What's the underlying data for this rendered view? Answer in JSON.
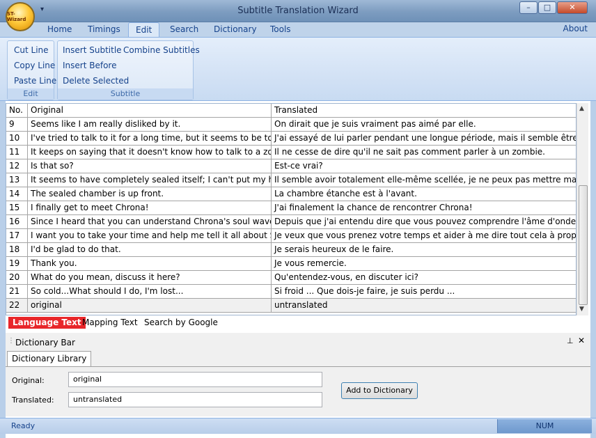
{
  "window": {
    "title": "Subtitle Translation Wizard",
    "app_button_label": "ST-Wizard",
    "minimize": "–",
    "maximize": "□",
    "close": "✕"
  },
  "ribbon_tabs": [
    "Home",
    "Timings",
    "Edit",
    "Search",
    "Dictionary",
    "Tools"
  ],
  "about_label": "About",
  "ribbon": {
    "edit_group": {
      "label": "Edit",
      "cut": "Cut Line",
      "copy": "Copy Line",
      "paste": "Paste Line"
    },
    "subtitle_group": {
      "label": "Subtitle",
      "insert": "Insert Subtitle",
      "insert_before": "Insert Before",
      "delete": "Delete Selected",
      "combine": "Combine Subtitles"
    }
  },
  "grid": {
    "headers": [
      "No.",
      "Original",
      "Translated"
    ],
    "rows": [
      {
        "no": "9",
        "orig": "Seems like I am really disliked by it.",
        "trans": "On dirait que je suis vraiment pas aimé par elle."
      },
      {
        "no": "10",
        "orig": "I've tried to talk to it for a long time, but it seems to be too scare...",
        "trans": "J'ai essayé de lui parler pendant une longue période, mais il semble être trop effr..."
      },
      {
        "no": "11",
        "orig": "It keeps on saying that it doesn't know how to talk to a zombie.",
        "trans": "Il ne cesse de dire qu'il ne sait pas comment parler à un zombie."
      },
      {
        "no": "12",
        "orig": "Is that so?",
        "trans": "Est-ce vrai?"
      },
      {
        "no": "13",
        "orig": "It seems to have completely sealed itself; I can't put my hand in.",
        "trans": "Il semble avoir totalement elle-même scellée, je ne peux pas mettre ma main po"
      },
      {
        "no": "14",
        "orig": "The sealed chamber is up front.",
        "trans": "La chambre étanche est à l'avant."
      },
      {
        "no": "15",
        "orig": "I finally get to meet Chrona!",
        "trans": "J'ai finalement la chance de rencontrer Chrona!"
      },
      {
        "no": "16",
        "orig": "Since I heard that you can understand Chrona's soul wavelengt...",
        "trans": "Depuis que j'ai entendu dire que vous pouvez comprendre l'âme d'onde Chrona ..."
      },
      {
        "no": "17",
        "orig": "I want you to take your time and help me tell it all about Shibus...",
        "trans": "Je veux que vous prenez votre temps et aider à me dire tout cela à propos Shibus..."
      },
      {
        "no": "18",
        "orig": "I'd be glad to do that.",
        "trans": "Je serais heureux de le faire."
      },
      {
        "no": "19",
        "orig": "Thank you.",
        "trans": "Je vous remercie."
      },
      {
        "no": "20",
        "orig": "What do you mean, discuss it here?",
        "trans": "Qu'entendez-vous, en discuter ici?"
      },
      {
        "no": "21",
        "orig": "So cold...What should I do, I'm lost...",
        "trans": "Si froid ... Que dois-je faire, je suis perdu ..."
      },
      {
        "no": "22",
        "orig": "original",
        "trans": "untranslated"
      }
    ]
  },
  "bottom_tabs": [
    "Language Text",
    "Mapping Text",
    "Search by Google"
  ],
  "dictionary": {
    "bar_title": "Dictionary Bar",
    "tab": "Dictionary Library",
    "original_label": "Original:",
    "original_value": "original",
    "translated_label": "Translated:",
    "translated_value": "untranslated",
    "add_button": "Add to Dictionary"
  },
  "status": {
    "ready": "Ready",
    "num": "NUM"
  },
  "colors": {
    "accent_tab": "#e8262a",
    "ribbon_text": "#15428b"
  }
}
